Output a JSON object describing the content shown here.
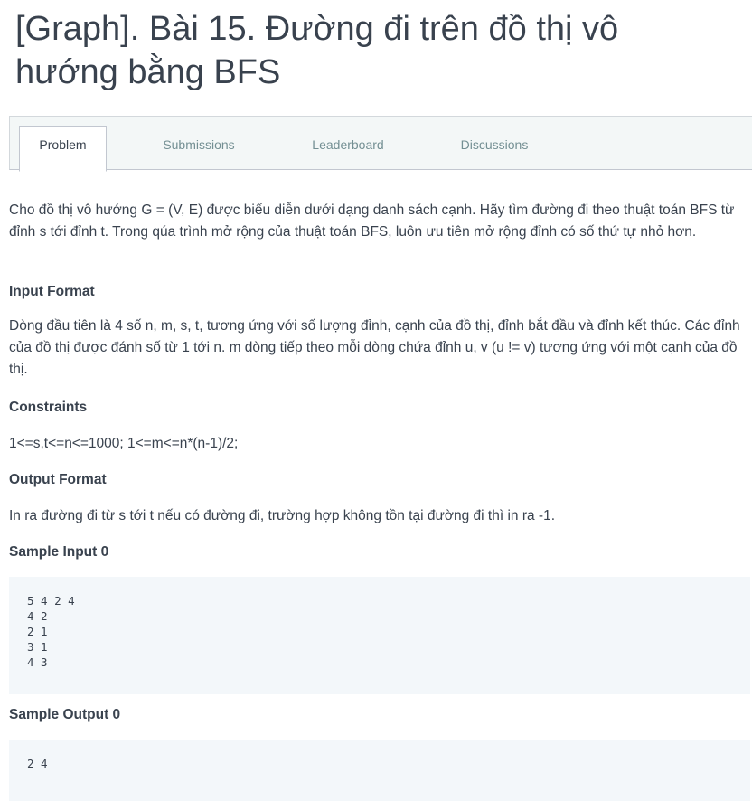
{
  "page": {
    "title": "[Graph]. Bài 15. Đường đi trên đồ thị vô hướng bằng BFS"
  },
  "tabs": [
    {
      "label": "Problem",
      "active": true
    },
    {
      "label": "Submissions",
      "active": false
    },
    {
      "label": "Leaderboard",
      "active": false
    },
    {
      "label": "Discussions",
      "active": false
    }
  ],
  "problem": {
    "statement": "Cho đồ thị vô hướng G = (V, E) được biểu diễn dưới dạng danh sách cạnh. Hãy tìm đường đi theo thuật toán BFS từ đỉnh s tới đỉnh t. Trong qúa trình mở rộng của thuật toán BFS, luôn ưu tiên mở rộng đỉnh có số thứ tự nhỏ hơn.",
    "input_format_heading": "Input Format",
    "input_format": "Dòng đầu tiên là 4 số n, m, s, t, tương ứng với số lượng đỉnh, cạnh của đồ thị, đỉnh bắt đầu và đỉnh kết thúc. Các đỉnh của đồ thị được đánh số từ 1 tới n. m dòng tiếp theo mỗi dòng chứa đỉnh u, v (u != v) tương ứng với một cạnh của đồ thị.",
    "constraints_heading": "Constraints",
    "constraints": "1<=s,t<=n<=1000; 1<=m<=n*(n-1)/2;",
    "output_format_heading": "Output Format",
    "output_format": "In ra đường đi từ s tới t nếu có đường đi, trường hợp không tồn tại đường đi thì in ra -1.",
    "sample_input_heading": "Sample Input 0",
    "sample_input": "5 4 2 4\n4 2\n2 1\n3 1\n4 3",
    "sample_output_heading": "Sample Output 0",
    "sample_output": "2 4"
  }
}
